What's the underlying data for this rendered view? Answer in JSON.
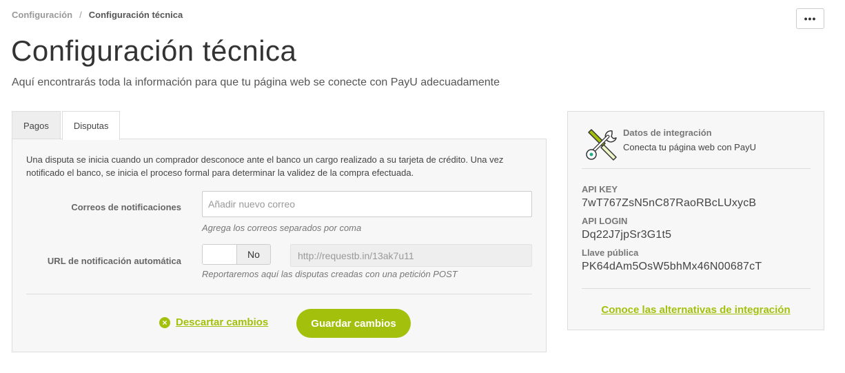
{
  "breadcrumb": {
    "parent": "Configuración",
    "separator": "/",
    "current": "Configuración técnica"
  },
  "header": {
    "more_label": "•••",
    "title": "Configuración técnica",
    "subtitle": "Aquí encontrarás toda la información para que tu página web se conecte con PayU adecuadamente"
  },
  "tabs": [
    {
      "label": "Pagos",
      "active": false
    },
    {
      "label": "Disputas",
      "active": true
    }
  ],
  "disputes": {
    "description": "Una disputa se inicia cuando un comprador desconoce ante el banco un cargo realizado a su tarjeta de crédito. Una vez notificado el banco, se inicia el proceso formal para determinar la validez de la compra efectuada.",
    "emails_label": "Correos de notificaciones",
    "emails_placeholder": "Añadir nuevo correo",
    "emails_value": "",
    "emails_help": "Agrega los correos separados por coma",
    "url_label": "URL de notificación automática",
    "toggle_state": "No",
    "url_value": "http://requestb.in/13ak7u11",
    "url_help": "Reportaremos aquí las disputas creadas con una petición POST",
    "discard_label": "Descartar cambios",
    "save_label": "Guardar cambios"
  },
  "integration": {
    "icon": "tools-icon",
    "title": "Datos de integración",
    "subtitle": "Conecta tu página web con PayU",
    "api_key_label": "API KEY",
    "api_key_value": "7wT767ZsN5nC87RaoRBcLUxycB",
    "api_login_label": "API LOGIN",
    "api_login_value": "Dq22J7jpSr3G1t5",
    "public_key_label": "Llave pública",
    "public_key_value": "PK64dAm5OsW5bhMx46N00687cT",
    "link_label": "Conoce las alternativas de integración"
  },
  "colors": {
    "accent": "#a3c00c",
    "panel_bg": "#f7f7f7",
    "border": "#dddddd"
  }
}
